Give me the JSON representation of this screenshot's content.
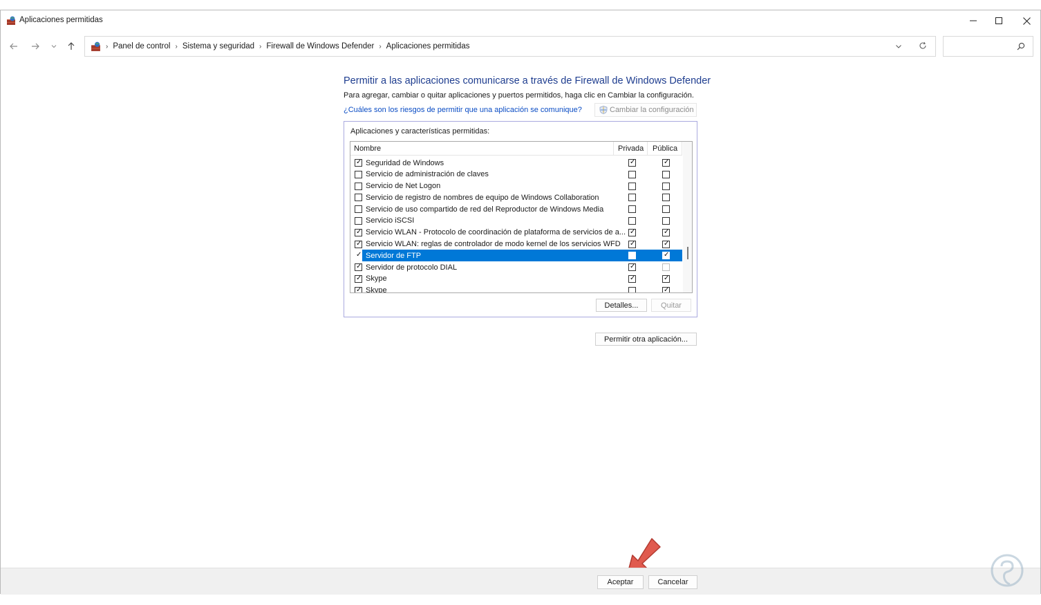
{
  "window": {
    "title": "Aplicaciones permitidas",
    "controls": [
      "minimize-icon",
      "maximize-icon",
      "close-icon"
    ]
  },
  "navigation": {
    "breadcrumb": [
      "Panel de control",
      "Sistema y seguridad",
      "Firewall de Windows Defender",
      "Aplicaciones permitidas"
    ],
    "search_placeholder": ""
  },
  "main": {
    "heading": "Permitir a las aplicaciones comunicarse a través de Firewall de Windows Defender",
    "description": "Para agregar, cambiar o quitar aplicaciones y puertos permitidos, haga clic en Cambiar la configuración.",
    "risk_link": "¿Cuáles son los riesgos de permitir que una aplicación se comunique?",
    "change_settings_label": "Cambiar la configuración",
    "group_label": "Aplicaciones y características permitidas:",
    "columns": {
      "name": "Nombre",
      "private": "Privada",
      "public": "Pública"
    },
    "apps": [
      {
        "name": "Seguridad de Windows",
        "enabled": true,
        "private": true,
        "public": true
      },
      {
        "name": "Servicio de administración de claves",
        "enabled": false,
        "private": false,
        "public": false
      },
      {
        "name": "Servicio de Net Logon",
        "enabled": false,
        "private": false,
        "public": false
      },
      {
        "name": "Servicio de registro de nombres de equipo de Windows Collaboration",
        "enabled": false,
        "private": false,
        "public": false
      },
      {
        "name": "Servicio de uso compartido de red del Reproductor de Windows Media",
        "enabled": false,
        "private": false,
        "public": false
      },
      {
        "name": "Servicio iSCSI",
        "enabled": false,
        "private": false,
        "public": false
      },
      {
        "name": "Servicio WLAN - Protocolo de coordinación de plataforma de servicios de a...",
        "enabled": true,
        "private": true,
        "public": true
      },
      {
        "name": "Servicio WLAN: reglas de controlador de modo kernel de los servicios WFD",
        "enabled": true,
        "private": true,
        "public": true
      },
      {
        "name": "Servidor de FTP",
        "enabled": true,
        "private": false,
        "public": true,
        "selected": true
      },
      {
        "name": "Servidor de protocolo DIAL",
        "enabled": true,
        "private": true,
        "public": false,
        "public_disabled": true
      },
      {
        "name": "Skype",
        "enabled": true,
        "private": true,
        "public": true
      },
      {
        "name": "Skype",
        "enabled": true,
        "private": false,
        "public": true
      }
    ],
    "details_button": "Detalles...",
    "remove_button": "Quitar",
    "allow_other_button": "Permitir otra aplicación..."
  },
  "footer": {
    "ok_button": "Aceptar",
    "cancel_button": "Cancelar"
  },
  "colors": {
    "heading": "#1e3d8f",
    "link": "#0a4cc4",
    "selection": "#0078d7",
    "annotation_arrow": "#e05a4e"
  }
}
